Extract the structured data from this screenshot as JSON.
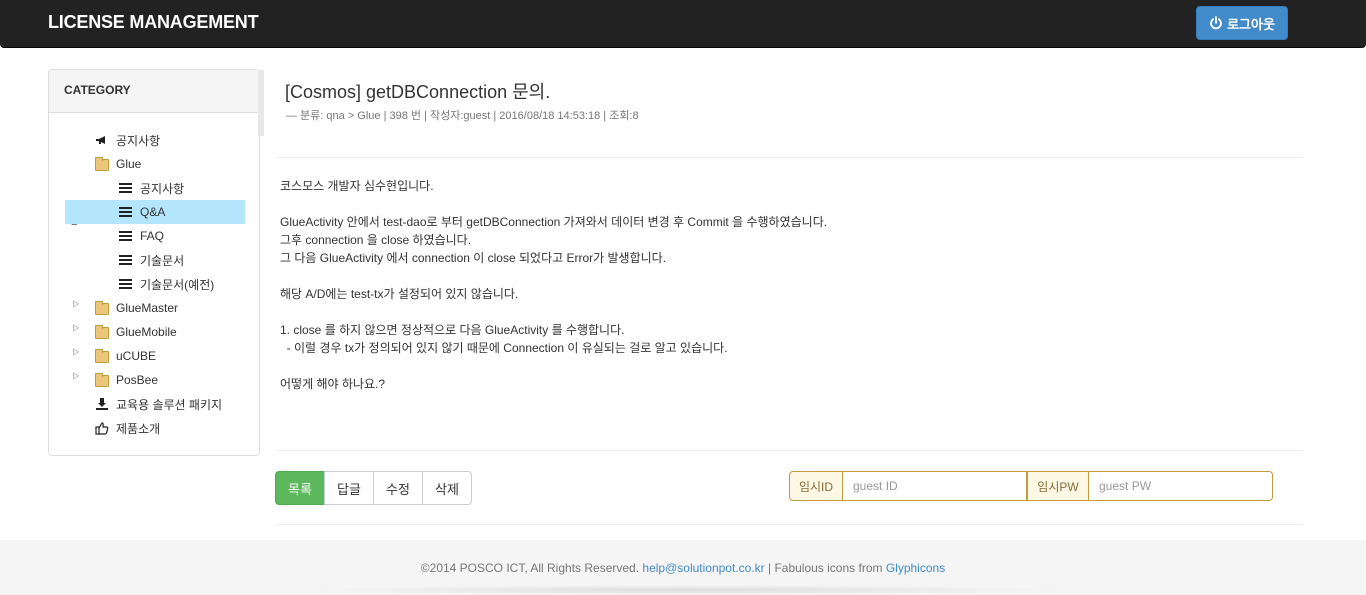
{
  "header": {
    "brand": "LICENSE MANAGEMENT",
    "logout_label": "로그아웃",
    "logout_icon": "power-icon"
  },
  "sidebar": {
    "title": "CATEGORY",
    "items": [
      {
        "label": "공지사항",
        "icon": "megaphone-icon"
      },
      {
        "label": "Glue",
        "icon": "folder-icon",
        "expanded": true
      },
      {
        "label": "공지사항",
        "icon": "list-icon"
      },
      {
        "label": "Q&A",
        "icon": "list-icon",
        "selected": true
      },
      {
        "label": "FAQ",
        "icon": "list-icon"
      },
      {
        "label": "기술문서",
        "icon": "list-icon"
      },
      {
        "label": "기술문서(예전)",
        "icon": "list-icon"
      },
      {
        "label": "GlueMaster",
        "icon": "folder-icon",
        "expanded": false
      },
      {
        "label": "GlueMobile",
        "icon": "folder-icon",
        "expanded": false
      },
      {
        "label": "uCUBE",
        "icon": "folder-icon",
        "expanded": false
      },
      {
        "label": "PosBee",
        "icon": "folder-icon",
        "expanded": false
      },
      {
        "label": "교육용 솔루션 패키지",
        "icon": "download-icon"
      },
      {
        "label": "제품소개",
        "icon": "thumbs-up-icon"
      }
    ]
  },
  "post": {
    "title": "[Cosmos] getDBConnection 문의.",
    "meta": "—  분류: qna > Glue | 398 번 | 작성자:guest | 2016/08/18 14:53:18 | 조회:8",
    "body": [
      "코스모스 개발자 심수현입니다.",
      "",
      "GlueActivity 안에서 test-dao로 부터 getDBConnection 가져와서 데이터 변경 후 Commit 을 수행하였습니다.",
      "그후 connection 을 close 하였습니다.",
      "그 다음 GlueActivity 에서 connection 이 close 되었다고 Error가 발생합니다.",
      "",
      "해당 A/D에는 test-tx가 설정되어 있지 않습니다.",
      "",
      "1. close 를 하지 않으면 정상적으로 다음 GlueActivity 를 수행합니다.",
      "  - 이럴 경우 tx가 정의되어 있지 않기 때문에 Connection 이 유실되는 걸로 알고 있습니다.",
      "",
      "어떻게 해야 하나요.?"
    ]
  },
  "actions": {
    "list_label": "목록",
    "reply_label": "답글",
    "edit_label": "수정",
    "delete_label": "삭제"
  },
  "guest": {
    "id_label": "임시ID",
    "id_placeholder": "guest ID",
    "pw_label": "임시PW",
    "pw_placeholder": "guest PW"
  },
  "footer": {
    "copyright": "©2014 POSCO ICT, All Rights Reserved.",
    "email": "help@solutionpot.co.kr",
    "sep": " | Fabulous icons from ",
    "icons_link": "Glyphicons"
  },
  "colors": {
    "navbar": "#222222",
    "primary": "#428bca",
    "success": "#5cb85c",
    "selected": "#b3e5fc",
    "warning_border": "#c79a3b"
  }
}
